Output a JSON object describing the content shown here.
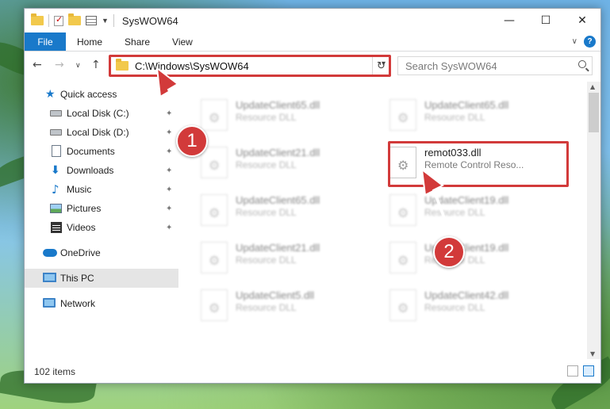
{
  "window": {
    "title": "SysWOW64",
    "controls": {
      "minimize": "—",
      "maximize": "☐",
      "close": "✕"
    }
  },
  "ribbon": {
    "file_tab": "File",
    "tabs": [
      "Home",
      "Share",
      "View"
    ],
    "help": "?",
    "expand": "∨"
  },
  "nav": {
    "back": "←",
    "forward": "→",
    "recent": "∨",
    "up": "↑",
    "address": "C:\\Windows\\SysWOW64",
    "refresh": "↻",
    "search_placeholder": "Search SysWOW64"
  },
  "sidebar": {
    "items": [
      {
        "label": "Quick access",
        "icon": "star-icon",
        "pinned": false
      },
      {
        "label": "Local Disk (C:)",
        "icon": "drive-icon",
        "pinned": true
      },
      {
        "label": "Local Disk (D:)",
        "icon": "drive-icon",
        "pinned": true
      },
      {
        "label": "Documents",
        "icon": "documents-icon",
        "pinned": true
      },
      {
        "label": "Downloads",
        "icon": "downloads-icon",
        "pinned": true
      },
      {
        "label": "Music",
        "icon": "music-icon",
        "pinned": true
      },
      {
        "label": "Pictures",
        "icon": "pictures-icon",
        "pinned": true
      },
      {
        "label": "Videos",
        "icon": "videos-icon",
        "pinned": true
      },
      {
        "label": "OneDrive",
        "icon": "onedrive-icon",
        "pinned": false
      },
      {
        "label": "This PC",
        "icon": "this-pc-icon",
        "pinned": false
      },
      {
        "label": "Network",
        "icon": "network-icon",
        "pinned": false
      }
    ],
    "pin_glyph": "📌"
  },
  "files": [
    {
      "name": "UpdateClient65.dll",
      "type": "Resource DLL",
      "blurred": true
    },
    {
      "name": "UpdateClient65.dll",
      "type": "Resource DLL",
      "blurred": true
    },
    {
      "name": "UpdateClient21.dll",
      "type": "Resource DLL",
      "blurred": true
    },
    {
      "name": "remot033.dll",
      "type": "Remote Control Reso...",
      "blurred": false
    },
    {
      "name": "UpdateClient65.dll",
      "type": "Resource DLL",
      "blurred": true
    },
    {
      "name": "UpdateClient19.dll",
      "type": "Resource DLL",
      "blurred": true
    },
    {
      "name": "UpdateClient21.dll",
      "type": "Resource DLL",
      "blurred": true
    },
    {
      "name": "UpdateClient19.dll",
      "type": "Resource DLL",
      "blurred": true
    },
    {
      "name": "UpdateClient5.dll",
      "type": "Resource DLL",
      "blurred": true
    },
    {
      "name": "UpdateClient42.dll",
      "type": "Resource DLL",
      "blurred": true
    }
  ],
  "status": {
    "item_count": "102 items"
  },
  "annotations": {
    "step1": "1",
    "step2": "2",
    "color": "#d23a3a"
  },
  "colors": {
    "accent": "#1979ca",
    "selection": "#cde8ff"
  }
}
